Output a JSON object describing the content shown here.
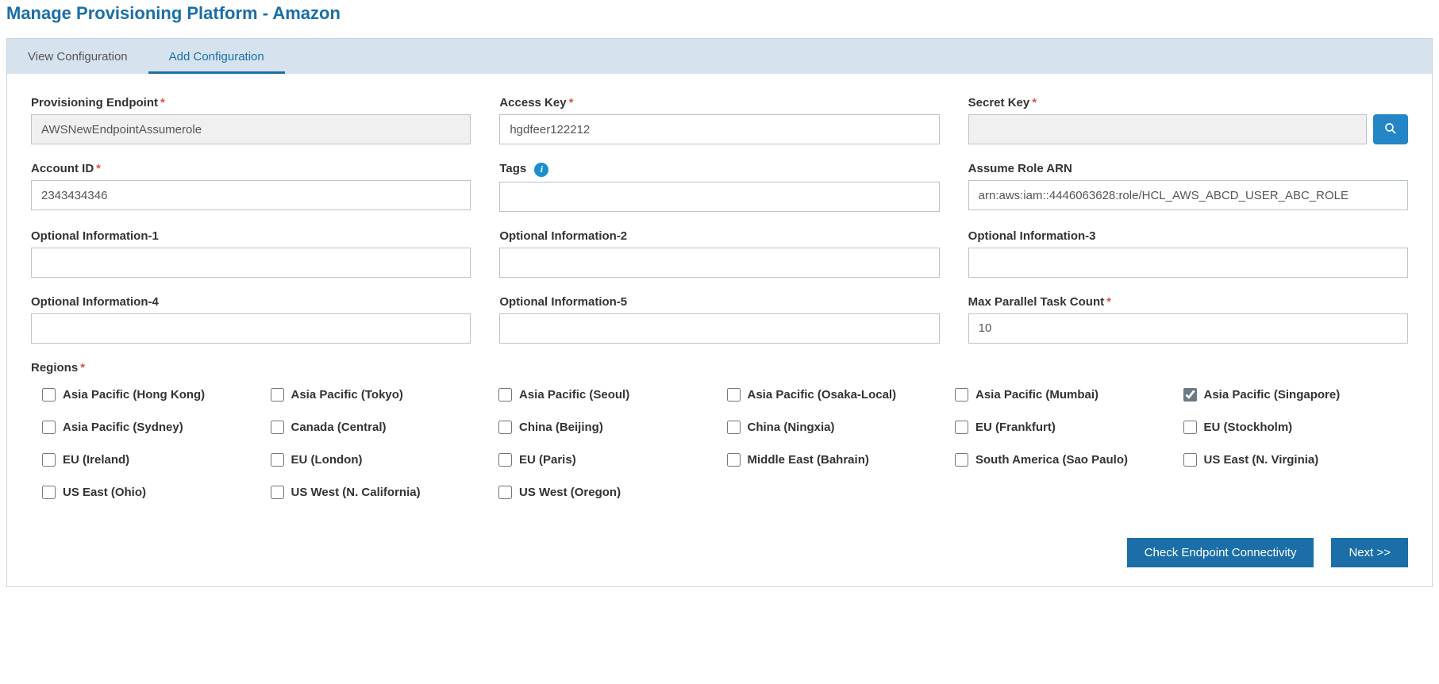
{
  "title": "Manage Provisioning Platform - Amazon",
  "tabs": [
    {
      "label": "View Configuration",
      "active": false
    },
    {
      "label": "Add Configuration",
      "active": true
    }
  ],
  "form": {
    "provisioning_endpoint": {
      "label": "Provisioning Endpoint",
      "required": true,
      "value": "AWSNewEndpointAssumerole",
      "readonly": true
    },
    "access_key": {
      "label": "Access Key",
      "required": true,
      "value": "hgdfeer122212",
      "readonly": false
    },
    "secret_key": {
      "label": "Secret Key",
      "required": true,
      "value": "",
      "readonly": true
    },
    "account_id": {
      "label": "Account ID",
      "required": true,
      "value": "2343434346",
      "readonly": false
    },
    "tags": {
      "label": "Tags",
      "required": false,
      "value": "",
      "readonly": false,
      "info": true
    },
    "assume_role_arn": {
      "label": "Assume Role ARN",
      "required": false,
      "value": "arn:aws:iam::4446063628:role/HCL_AWS_ABCD_USER_ABC_ROLE",
      "readonly": false
    },
    "opt1": {
      "label": "Optional Information-1",
      "required": false,
      "value": "",
      "readonly": false
    },
    "opt2": {
      "label": "Optional Information-2",
      "required": false,
      "value": "",
      "readonly": false
    },
    "opt3": {
      "label": "Optional Information-3",
      "required": false,
      "value": "",
      "readonly": false
    },
    "opt4": {
      "label": "Optional Information-4",
      "required": false,
      "value": "",
      "readonly": false
    },
    "opt5": {
      "label": "Optional Information-5",
      "required": false,
      "value": "",
      "readonly": false
    },
    "max_parallel": {
      "label": "Max Parallel Task Count",
      "required": true,
      "value": "10",
      "readonly": false
    }
  },
  "regions_label": "Regions",
  "regions": [
    {
      "label": "Asia Pacific (Hong Kong)",
      "checked": false
    },
    {
      "label": "Asia Pacific (Tokyo)",
      "checked": false
    },
    {
      "label": "Asia Pacific (Seoul)",
      "checked": false
    },
    {
      "label": "Asia Pacific (Osaka-Local)",
      "checked": false
    },
    {
      "label": "Asia Pacific (Mumbai)",
      "checked": false
    },
    {
      "label": "Asia Pacific (Singapore)",
      "checked": true
    },
    {
      "label": "Asia Pacific (Sydney)",
      "checked": false
    },
    {
      "label": "Canada (Central)",
      "checked": false
    },
    {
      "label": "China (Beijing)",
      "checked": false
    },
    {
      "label": "China (Ningxia)",
      "checked": false
    },
    {
      "label": "EU (Frankfurt)",
      "checked": false
    },
    {
      "label": "EU (Stockholm)",
      "checked": false
    },
    {
      "label": "EU (Ireland)",
      "checked": false
    },
    {
      "label": "EU (London)",
      "checked": false
    },
    {
      "label": "EU (Paris)",
      "checked": false
    },
    {
      "label": "Middle East (Bahrain)",
      "checked": false
    },
    {
      "label": "South America (Sao Paulo)",
      "checked": false
    },
    {
      "label": "US East (N. Virginia)",
      "checked": false
    },
    {
      "label": "US East (Ohio)",
      "checked": false
    },
    {
      "label": "US West (N. California)",
      "checked": false
    },
    {
      "label": "US West (Oregon)",
      "checked": false
    }
  ],
  "buttons": {
    "check": "Check Endpoint Connectivity",
    "next": "Next >>"
  }
}
